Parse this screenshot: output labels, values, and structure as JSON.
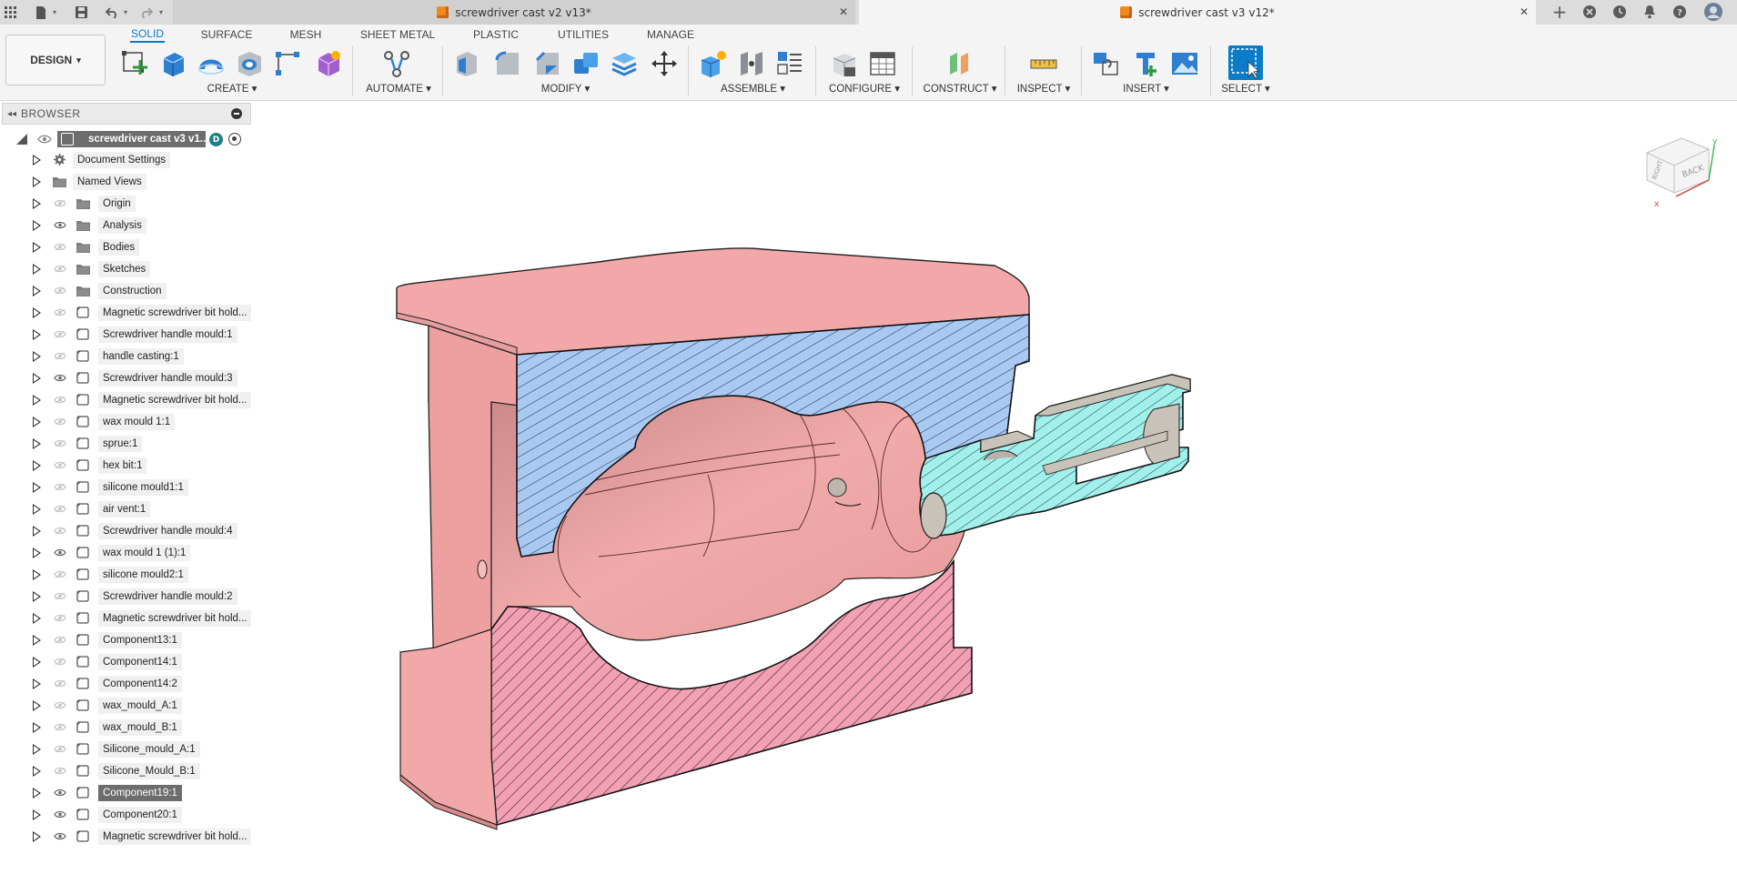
{
  "titlebar": {
    "tabs": [
      {
        "label": "screwdriver cast v2 v13*",
        "active": false
      },
      {
        "label": "screwdriver cast v3 v12*",
        "active": true
      }
    ],
    "close_glyph": "✕",
    "new_tab_glyph": "+",
    "icons": [
      "apps-grid-icon",
      "file-icon",
      "save-icon",
      "undo-icon",
      "redo-icon",
      "extensions-icon",
      "job-status-icon",
      "notifications-icon",
      "help-icon",
      "user-avatar-icon"
    ]
  },
  "ribbon": {
    "workspace": "DESIGN",
    "tabs": [
      "SOLID",
      "SURFACE",
      "MESH",
      "SHEET METAL",
      "PLASTIC",
      "UTILITIES",
      "MANAGE"
    ],
    "active_tab": "SOLID",
    "groups": [
      {
        "label": "CREATE ▾"
      },
      {
        "label": "AUTOMATE ▾"
      },
      {
        "label": "MODIFY ▾"
      },
      {
        "label": "ASSEMBLE ▾"
      },
      {
        "label": "CONFIGURE ▾"
      },
      {
        "label": "CONSTRUCT ▾"
      },
      {
        "label": "INSPECT ▾"
      },
      {
        "label": "INSERT ▾"
      },
      {
        "label": "SELECT ▾"
      }
    ],
    "accent_color": "#0a7cc8"
  },
  "browser": {
    "title": "BROWSER",
    "root": {
      "label": "screwdriver cast v3 v1...",
      "badge": "D"
    },
    "items": [
      {
        "label": "Document Settings",
        "icon": "gear-icon",
        "eye": false,
        "indent": 1
      },
      {
        "label": "Named Views",
        "icon": "folder-icon",
        "eye": false,
        "indent": 1
      },
      {
        "label": "Origin",
        "icon": "folder-icon",
        "eye": "hidden"
      },
      {
        "label": "Analysis",
        "icon": "folder-icon",
        "eye": "visible"
      },
      {
        "label": "Bodies",
        "icon": "folder-icon",
        "eye": "hidden"
      },
      {
        "label": "Sketches",
        "icon": "folder-icon",
        "eye": "hidden"
      },
      {
        "label": "Construction",
        "icon": "folder-icon",
        "eye": "hidden"
      },
      {
        "label": "Magnetic screwdriver bit hold...",
        "icon": "component-icon",
        "eye": "hidden"
      },
      {
        "label": "Screwdriver handle mould:1",
        "icon": "component-icon",
        "eye": "hidden"
      },
      {
        "label": "handle casting:1",
        "icon": "component-icon",
        "eye": "hidden"
      },
      {
        "label": "Screwdriver handle mould:3",
        "icon": "component-icon",
        "eye": "visible"
      },
      {
        "label": "Magnetic screwdriver bit hold...",
        "icon": "component-icon",
        "eye": "hidden"
      },
      {
        "label": "wax mould 1:1",
        "icon": "component-icon",
        "eye": "hidden"
      },
      {
        "label": "sprue:1",
        "icon": "component-icon",
        "eye": "hidden"
      },
      {
        "label": "hex bit:1",
        "icon": "component-icon",
        "eye": "hidden"
      },
      {
        "label": "silicone mould1:1",
        "icon": "component-icon",
        "eye": "hidden"
      },
      {
        "label": "air vent:1",
        "icon": "component-icon",
        "eye": "hidden"
      },
      {
        "label": "Screwdriver handle mould:4",
        "icon": "component-icon",
        "eye": "hidden"
      },
      {
        "label": "wax mould 1 (1):1",
        "icon": "component-icon",
        "eye": "visible"
      },
      {
        "label": "silicone mould2:1",
        "icon": "component-icon",
        "eye": "hidden"
      },
      {
        "label": "Screwdriver handle mould:2",
        "icon": "component-icon",
        "eye": "hidden"
      },
      {
        "label": "Magnetic screwdriver bit hold...",
        "icon": "component-icon",
        "eye": "hidden"
      },
      {
        "label": "Component13:1",
        "icon": "component-icon",
        "eye": "hidden"
      },
      {
        "label": "Component14:1",
        "icon": "component-icon",
        "eye": "hidden"
      },
      {
        "label": "Component14:2",
        "icon": "component-icon",
        "eye": "hidden"
      },
      {
        "label": "wax_mould_A:1",
        "icon": "component-icon",
        "eye": "hidden"
      },
      {
        "label": "wax_mould_B:1",
        "icon": "component-icon",
        "eye": "hidden"
      },
      {
        "label": "Silicone_mould_A:1",
        "icon": "component-icon",
        "eye": "hidden"
      },
      {
        "label": "Silicone_Mould_B:1",
        "icon": "component-icon",
        "eye": "hidden"
      },
      {
        "label": "Component19:1",
        "icon": "component-icon",
        "eye": "visible",
        "selected": true
      },
      {
        "label": "Component20:1",
        "icon": "component-icon",
        "eye": "visible"
      },
      {
        "label": "Magnetic screwdriver bit hold...",
        "icon": "component-icon",
        "eye": "visible"
      }
    ]
  },
  "viewcube": {
    "faces": [
      "RIGHT",
      "BACK"
    ]
  },
  "colors": {
    "mould_body": "#f2a8a8",
    "section_blue": "#a9c8f2",
    "section_cyan": "#a2f0ec",
    "section_pink": "#f2a0b4",
    "selection": "#6d6d6d"
  }
}
